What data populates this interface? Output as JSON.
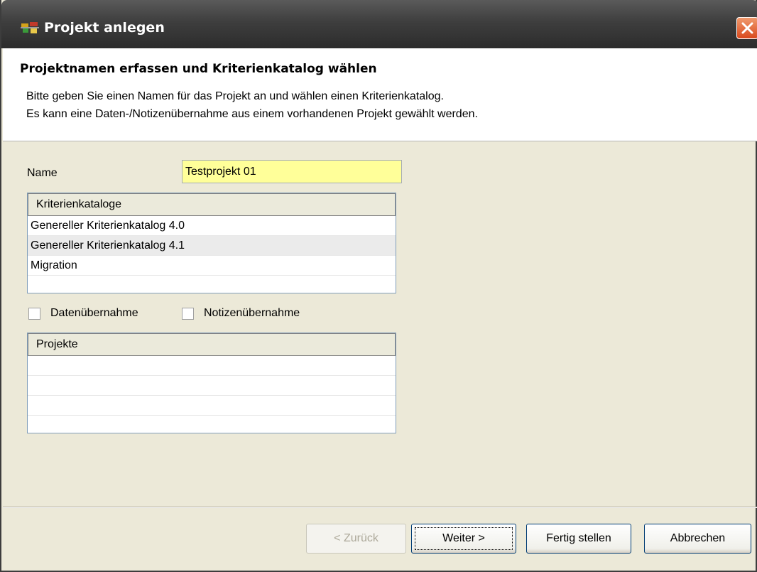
{
  "window": {
    "title": "Projekt anlegen",
    "app_icon": "app-icon",
    "close_icon": "close-icon"
  },
  "header": {
    "title": "Projektnamen erfassen und Kriterienkatalog wählen",
    "desc_line1": "Bitte geben Sie einen Namen für das Projekt an und wählen einen Kriterienkatalog.",
    "desc_line2": "Es kann eine Daten-/Notizenübernahme aus einem vorhandenen Projekt gewählt werden."
  },
  "form": {
    "name_label": "Name",
    "name_value": "Testprojekt 01",
    "catalog_header": "Kriterienkataloge",
    "catalogs": [
      "Genereller Kriterienkatalog 4.0",
      "Genereller Kriterienkatalog 4.1",
      "Migration"
    ],
    "data_transfer_label": "Datenübernahme",
    "notes_transfer_label": "Notizenübernahme",
    "projects_header": "Projekte"
  },
  "buttons": {
    "back": "< Zurück",
    "next": "Weiter >",
    "finish": "Fertig stellen",
    "cancel": "Abbrechen"
  },
  "colors": {
    "input_highlight": "#ffff99",
    "close_button": "#d9491d"
  }
}
